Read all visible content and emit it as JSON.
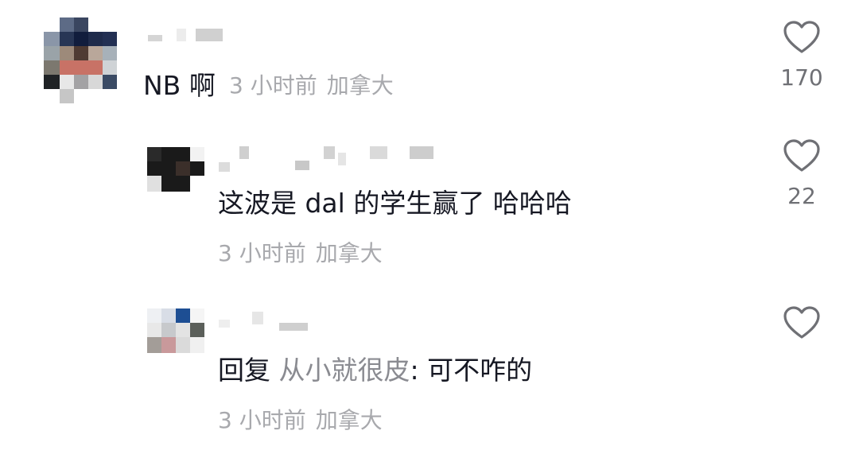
{
  "colors": {
    "text": "#161823",
    "meta": "#a8a9ad",
    "reply_name": "#8a8b91",
    "like_outline": "#6f7075"
  },
  "comments": [
    {
      "text": "NB 啊",
      "time": "3 小时前",
      "location": "加拿大",
      "likes": "170",
      "like_icon": "heart-outline-icon"
    },
    {
      "text": "这波是 dal 的学生赢了 哈哈哈",
      "time": "3 小时前",
      "location": "加拿大",
      "likes": "22",
      "like_icon": "heart-outline-icon"
    },
    {
      "reply_prefix": "回复",
      "reply_to": "从小就很皮",
      "reply_body": ": 可不咋的",
      "time": "3 小时前",
      "location": "加拿大",
      "likes": "",
      "like_icon": "heart-outline-icon"
    }
  ]
}
